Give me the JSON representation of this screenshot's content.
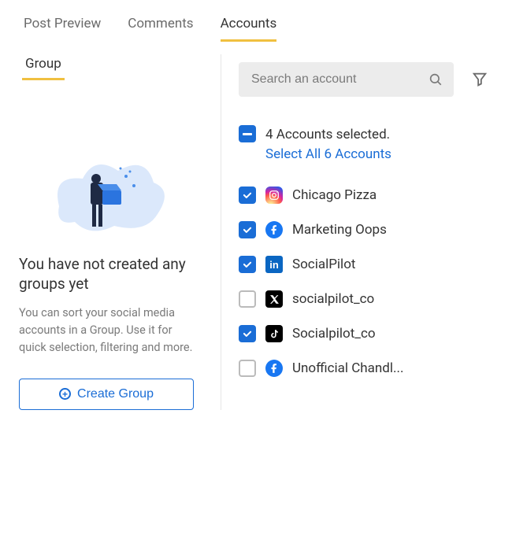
{
  "tabs": {
    "post_preview": "Post Preview",
    "comments": "Comments",
    "accounts": "Accounts"
  },
  "subtab": "Group",
  "empty": {
    "title": "You have not created any groups yet",
    "desc": "You can sort your social media accounts in a Group. Use it for quick selection, filtering and more.",
    "button": "Create Group"
  },
  "search": {
    "placeholder": "Search an account"
  },
  "selection": {
    "summary": "4 Accounts selected.",
    "link": "Select All 6 Accounts"
  },
  "accounts": [
    {
      "name": "Chicago Pizza",
      "platform": "instagram",
      "checked": true
    },
    {
      "name": "Marketing Oops",
      "platform": "facebook",
      "checked": true
    },
    {
      "name": "SocialPilot",
      "platform": "linkedin",
      "checked": true
    },
    {
      "name": "socialpilot_co",
      "platform": "x",
      "checked": false
    },
    {
      "name": "Socialpilot_co",
      "platform": "tiktok",
      "checked": true
    },
    {
      "name": "Unofficial Chandl...",
      "platform": "facebook",
      "checked": false
    }
  ]
}
